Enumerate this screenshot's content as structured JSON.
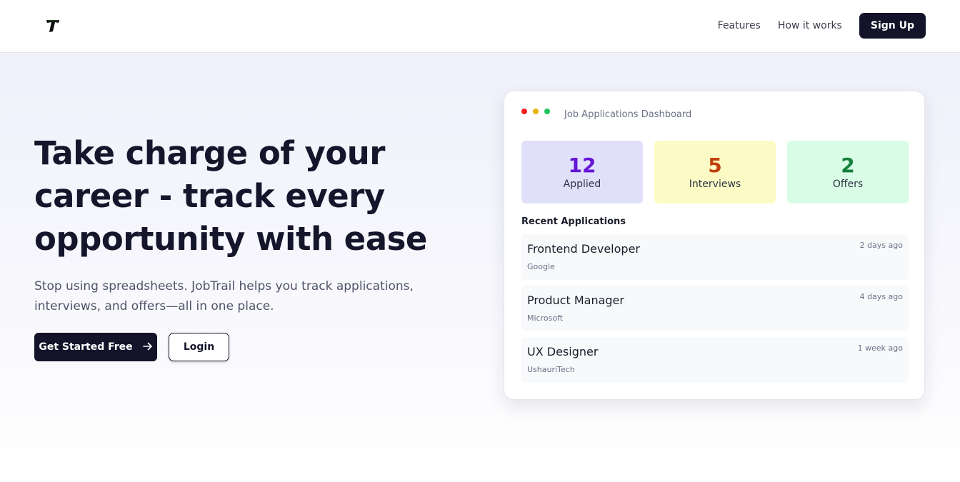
{
  "header": {
    "logo_letter": "T",
    "nav": {
      "features": "Features",
      "how_it_works": "How it works"
    },
    "signup_label": "Sign Up"
  },
  "hero": {
    "headline_lines": [
      "Take charge of your",
      "career - track every",
      "opportunity with ease"
    ],
    "subtext_lines": [
      "Stop using spreadsheets. JobTrail helps you track applications,",
      "interviews, and offers—all in one place."
    ],
    "primary_cta": "Get Started Free",
    "primary_cta_icon": "arrow-right-icon",
    "login_label": "Login"
  },
  "dashboard": {
    "title": "Job Applications Dashboard",
    "window_dots": [
      "#ef1e1e",
      "#eab308",
      "#22c55e"
    ],
    "stats": [
      {
        "value": "12",
        "label": "Applied",
        "bg": "#e0e0fb",
        "color": "#6515d6"
      },
      {
        "value": "5",
        "label": "Interviews",
        "bg": "#fdfbc5",
        "color": "#c2410c"
      },
      {
        "value": "2",
        "label": "Offers",
        "bg": "#d9fce6",
        "color": "#15803d"
      }
    ],
    "recent_title": "Recent Applications",
    "applications": [
      {
        "role": "Frontend Developer",
        "company": "Google",
        "time": "2 days ago"
      },
      {
        "role": "Product Manager",
        "company": "Microsoft",
        "time": "4 days ago"
      },
      {
        "role": "UX Designer",
        "company": "UshauriTech",
        "time": "1 week ago"
      }
    ]
  }
}
